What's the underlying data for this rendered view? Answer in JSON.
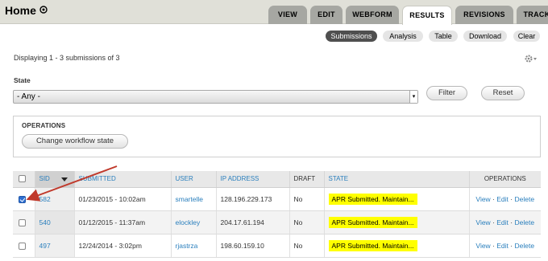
{
  "header": {
    "title": "Home",
    "tabs": [
      {
        "label": "VIEW",
        "active": false
      },
      {
        "label": "EDIT",
        "active": false
      },
      {
        "label": "WEBFORM",
        "active": false
      },
      {
        "label": "RESULTS",
        "active": true
      },
      {
        "label": "REVISIONS",
        "active": false
      },
      {
        "label": "TRACK",
        "active": false
      }
    ]
  },
  "subtabs": [
    {
      "label": "Submissions",
      "active": true
    },
    {
      "label": "Analysis",
      "active": false
    },
    {
      "label": "Table",
      "active": false
    },
    {
      "label": "Download",
      "active": false
    },
    {
      "label": "Clear",
      "active": false
    }
  ],
  "summary": "Displaying 1 - 3 submissions of 3",
  "filter": {
    "label": "State",
    "selected": "- Any -",
    "filter_button": "Filter",
    "reset_button": "Reset"
  },
  "operations": {
    "title": "OPERATIONS",
    "button": "Change workflow state"
  },
  "table": {
    "columns": [
      "SID",
      "SUBMITTED",
      "USER",
      "IP ADDRESS",
      "DRAFT",
      "STATE",
      "OPERATIONS"
    ],
    "rows": [
      {
        "checked": true,
        "sid": "582",
        "submitted": "01/23/2015 - 10:02am",
        "user": "smartelle",
        "ip": "128.196.229.173",
        "draft": "No",
        "state": "APR Submitted. Maintain...",
        "ops": [
          "View",
          "Edit",
          "Delete"
        ]
      },
      {
        "checked": false,
        "sid": "540",
        "submitted": "01/12/2015 - 11:37am",
        "user": "elockley",
        "ip": "204.17.61.194",
        "draft": "No",
        "state": "APR Submitted. Maintain...",
        "ops": [
          "View",
          "Edit",
          "Delete"
        ]
      },
      {
        "checked": false,
        "sid": "497",
        "submitted": "12/24/2014 - 3:02pm",
        "user": "rjastrza",
        "ip": "198.60.159.10",
        "draft": "No",
        "state": "APR Submitted. Maintain...",
        "ops": [
          "View",
          "Edit",
          "Delete"
        ]
      }
    ],
    "ops_separator": " · "
  },
  "colors": {
    "highlight": "#ffff00",
    "link": "#2a7fbd",
    "annotation_arrow": "#c0392b"
  },
  "icons": [
    "plus-circle-icon",
    "gear-icon",
    "chevron-down-icon",
    "sort-desc-icon",
    "red-arrow-annotation"
  ]
}
